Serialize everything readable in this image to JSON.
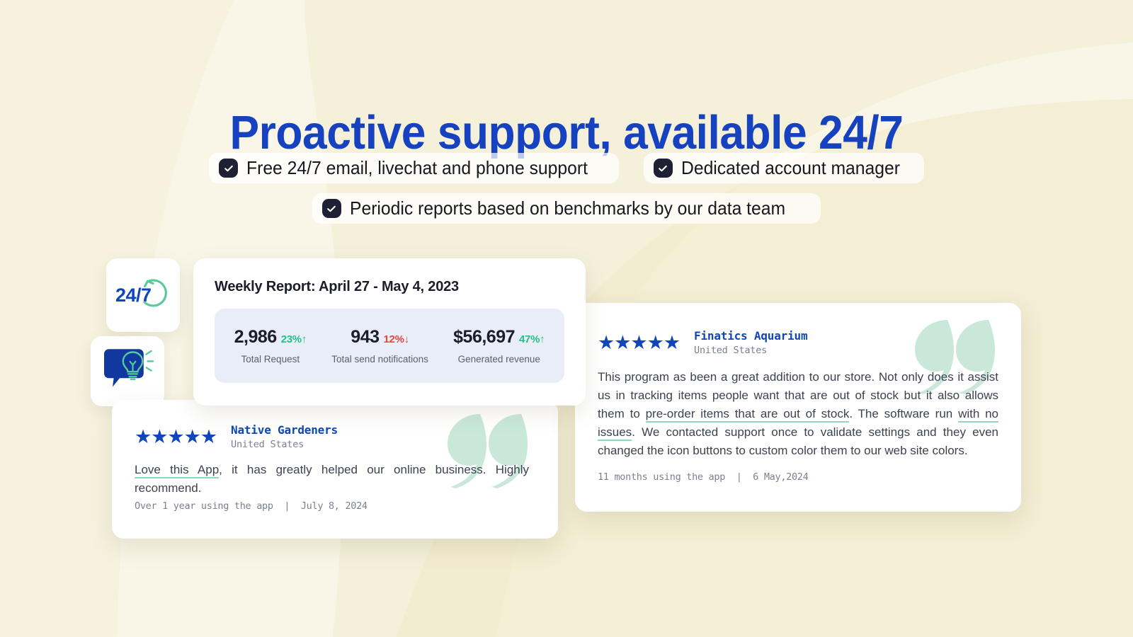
{
  "theme": {
    "bg_base": "#F3EED4",
    "bg_light": "#F9F6E8",
    "bg_mid": "#F0E9C8",
    "brand_blue": "#1641BF",
    "star_blue": "#1046B8",
    "dark": "#1F2033",
    "green": "#22C08B",
    "red": "#F04438",
    "mint": "#C9E8DA",
    "panel_blue": "#E8EDF7",
    "underline_green": "#8FD9BB"
  },
  "headline": "Proactive support, available 24/7",
  "features": {
    "row1": [
      {
        "icon": "check-circle-icon",
        "label": "Free 24/7 email, livechat and phone support"
      },
      {
        "icon": "check-circle-icon",
        "label": "Dedicated account manager"
      }
    ],
    "row2": [
      {
        "icon": "check-circle-icon",
        "label": "Periodic reports based on benchmarks by our data team"
      }
    ]
  },
  "tiles": {
    "support_badge": {
      "icon": "refresh-arc-icon",
      "label": "24/7"
    },
    "chat_idea": {
      "icon": "chat-bubble-lightbulb-icon"
    }
  },
  "report": {
    "title": "Weekly Report: April 27 - May 4, 2023",
    "stats": [
      {
        "value": "2,986",
        "delta": "23%",
        "arrow": "↑",
        "direction": "up",
        "label": "Total Request"
      },
      {
        "value": "943",
        "delta": "12%",
        "arrow": "↓",
        "direction": "down",
        "label": "Total send notifications"
      },
      {
        "value": "$56,697",
        "delta": "47%",
        "arrow": "↑",
        "direction": "up",
        "label": "Generated revenue"
      }
    ]
  },
  "testimonials": [
    {
      "id": "native-gardeners",
      "rating": 5,
      "stars": "★★★★★",
      "author": "Native Gardeners",
      "location": "United States",
      "body_before": "",
      "body_highlight": "Love this App",
      "body_after": ", it has greatly helped our online business. Highly recommend.",
      "duration": "Over 1 year using the app",
      "separator": "|",
      "date": "July 8, 2024",
      "footer": "Over 1 year using the app  |  July 8, 2024"
    },
    {
      "id": "finatics-aquarium",
      "rating": 5,
      "stars": "★★★★★",
      "author": "Finatics Aquarium",
      "location": "United States",
      "body_part1": "This program as been a great addition to our store. Not only does it assist us in tracking items people want that are out of stock but it also allows them to ",
      "body_highlight1": "pre-order items that are out of stock",
      "body_part2": ". The software run ",
      "body_highlight2": "with no issues",
      "body_part3": ". We contacted support once to validate settings and they even changed the icon buttons to custom color them to our web site colors.",
      "duration": "11 months using the app",
      "separator": "|",
      "date": "6 May,2024",
      "footer": "11 months using the app  |  6 May,2024"
    }
  ]
}
